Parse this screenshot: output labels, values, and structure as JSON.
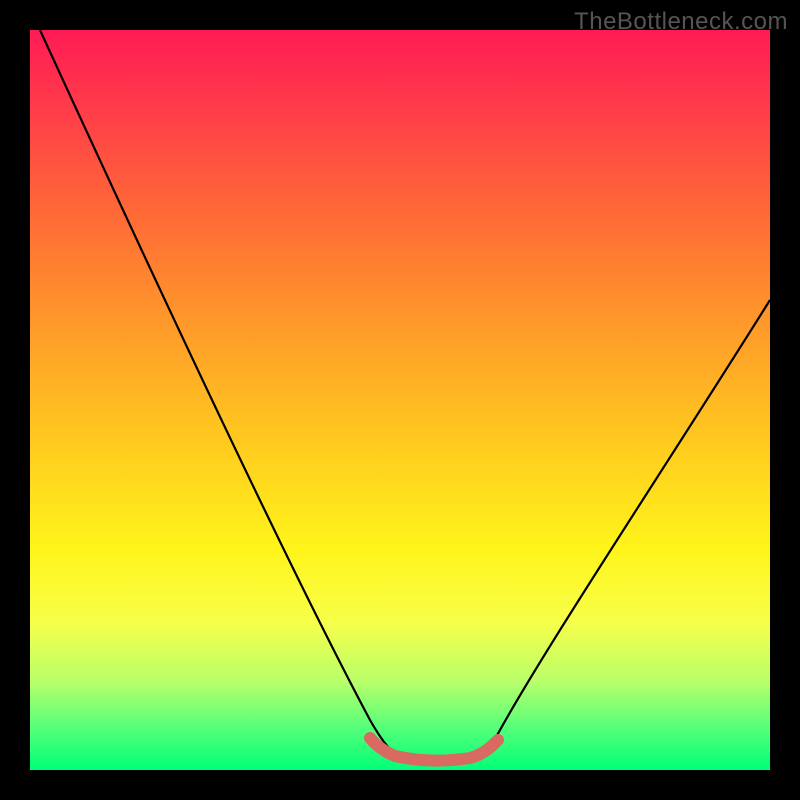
{
  "watermark": "TheBottleneck.com",
  "chart_data": {
    "type": "line",
    "title": "",
    "xlabel": "",
    "ylabel": "",
    "xlim": [
      0,
      100
    ],
    "ylim": [
      0,
      100
    ],
    "series": [
      {
        "name": "bottleneck-curve",
        "x": [
          0,
          5,
          10,
          15,
          20,
          25,
          30,
          35,
          40,
          45,
          48,
          50,
          52,
          55,
          58,
          60,
          62,
          65,
          70,
          75,
          80,
          85,
          90,
          95,
          100
        ],
        "y": [
          100,
          91,
          82,
          73,
          64,
          55,
          46,
          37,
          27,
          16,
          8,
          4,
          2,
          1,
          1,
          2,
          4,
          8,
          16,
          24,
          32,
          40,
          48,
          56,
          64
        ]
      },
      {
        "name": "optimal-band",
        "x": [
          48,
          50,
          52,
          55,
          58,
          60,
          62
        ],
        "y": [
          4,
          2.5,
          2,
          1.5,
          2,
          2.5,
          4
        ]
      }
    ],
    "gradient_stops": [
      {
        "pos": 0.0,
        "color": "#ff1b54"
      },
      {
        "pos": 0.1,
        "color": "#ff3a4a"
      },
      {
        "pos": 0.25,
        "color": "#ff6a36"
      },
      {
        "pos": 0.4,
        "color": "#ff9a2a"
      },
      {
        "pos": 0.55,
        "color": "#ffc81f"
      },
      {
        "pos": 0.7,
        "color": "#fff41a"
      },
      {
        "pos": 0.8,
        "color": "#f7ff4a"
      },
      {
        "pos": 0.88,
        "color": "#b9ff6a"
      },
      {
        "pos": 0.94,
        "color": "#5aff7a"
      },
      {
        "pos": 1.0,
        "color": "#00ff77"
      }
    ]
  }
}
